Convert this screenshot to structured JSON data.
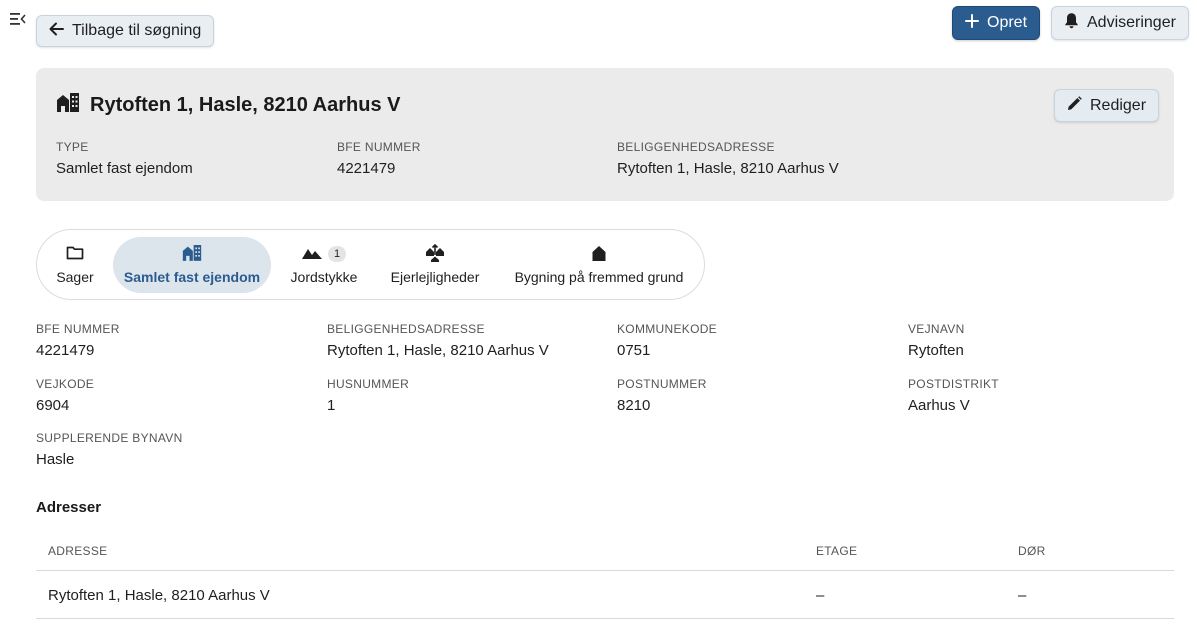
{
  "topbar": {
    "back_label": "Tilbage til søgning",
    "create_label": "Opret",
    "notifications_label": "Adviseringer"
  },
  "header": {
    "title": "Rytoften 1, Hasle, 8210 Aarhus V",
    "edit_label": "Rediger",
    "fields": [
      {
        "label": "TYPE",
        "value": "Samlet fast ejendom"
      },
      {
        "label": "BFE NUMMER",
        "value": "4221479"
      },
      {
        "label": "BELIGGENHEDSADRESSE",
        "value": "Rytoften 1, Hasle, 8210 Aarhus V"
      }
    ]
  },
  "tabs": [
    {
      "label": "Sager",
      "icon": "folder-icon",
      "active": false
    },
    {
      "label": "Samlet fast ejendom",
      "icon": "building-icon",
      "active": true
    },
    {
      "label": "Jordstykke",
      "icon": "terrain-icon",
      "badge": "1",
      "active": false
    },
    {
      "label": "Ejerlejligheder",
      "icon": "apartments-icon",
      "active": false
    },
    {
      "label": "Bygning på fremmed grund",
      "icon": "house-icon",
      "active": false
    }
  ],
  "details": [
    {
      "label": "BFE NUMMER",
      "value": "4221479"
    },
    {
      "label": "BELIGGENHEDSADRESSE",
      "value": "Rytoften 1, Hasle, 8210 Aarhus V"
    },
    {
      "label": "KOMMUNEKODE",
      "value": "0751"
    },
    {
      "label": "VEJNAVN",
      "value": "Rytoften"
    },
    {
      "label": "VEJKODE",
      "value": "6904"
    },
    {
      "label": "HUSNUMMER",
      "value": "1"
    },
    {
      "label": "POSTNUMMER",
      "value": "8210"
    },
    {
      "label": "POSTDISTRIKT",
      "value": "Aarhus V"
    },
    {
      "label": "SUPPLERENDE BYNAVN",
      "value": "Hasle"
    }
  ],
  "addresses": {
    "title": "Adresser",
    "columns": [
      "ADRESSE",
      "ETAGE",
      "DØR"
    ],
    "rows": [
      [
        "Rytoften 1, Hasle, 8210 Aarhus V",
        "–",
        "–"
      ]
    ]
  },
  "colors": {
    "primary": "#2b5c8f",
    "header_bg": "#ebebeb",
    "active_tab_bg": "#dce4ec"
  }
}
